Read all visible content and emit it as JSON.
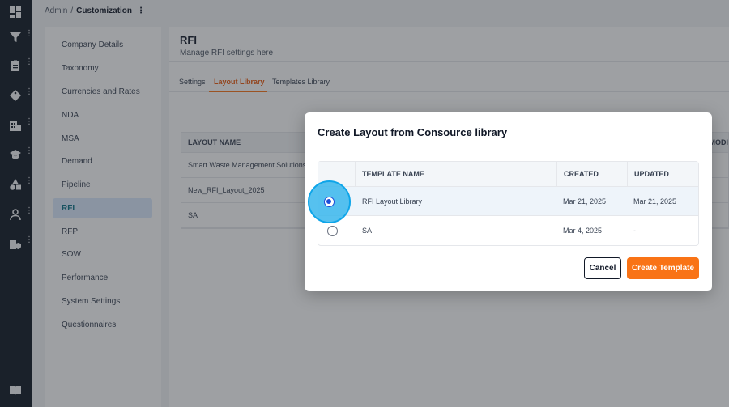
{
  "rail": {
    "items": [
      {
        "icon": "dashboard-icon"
      },
      {
        "icon": "filter-icon"
      },
      {
        "icon": "clipboard-icon"
      },
      {
        "icon": "tag-icon"
      },
      {
        "icon": "building-icon"
      },
      {
        "icon": "graduation-cap-icon"
      },
      {
        "icon": "shapes-icon"
      },
      {
        "icon": "user-icon"
      },
      {
        "icon": "shield-building-icon"
      }
    ],
    "bottom_icon": "book-icon"
  },
  "breadcrumb": {
    "parent": "Admin",
    "separator": "/",
    "current": "Customization",
    "kebab": "⋮"
  },
  "nav": {
    "items": [
      "Company Details",
      "Taxonomy",
      "Currencies and Rates",
      "NDA",
      "MSA",
      "Demand",
      "Pipeline",
      "RFI",
      "RFP",
      "SOW",
      "Performance",
      "System Settings",
      "Questionnaires"
    ],
    "active": "RFI"
  },
  "main": {
    "title": "RFI",
    "subtitle": "Manage RFI settings here",
    "tabs": [
      "Settings",
      "Layout Library",
      "Templates Library"
    ],
    "active_tab": "Layout Library",
    "table": {
      "header": "LAYOUT NAME",
      "header_right": "MODI",
      "rows": [
        "Smart Waste Management Solutions",
        "New_RFI_Layout_2025",
        "SA"
      ]
    }
  },
  "modal": {
    "title": "Create Layout from Consource library",
    "columns": [
      "TEMPLATE NAME",
      "CREATED",
      "UPDATED"
    ],
    "rows": [
      {
        "name": "RFI Layout Library",
        "created": "Mar 21, 2025",
        "updated": "Mar 21, 2025",
        "selected": true
      },
      {
        "name": "SA",
        "created": "Mar 4, 2025",
        "updated": "-",
        "selected": false
      }
    ],
    "cancel_label": "Cancel",
    "create_label": "Create Template"
  },
  "colors": {
    "accent": "#f97316",
    "rail": "#0f1923",
    "active_nav_bg": "#dbeafe",
    "highlight": "#38b6ec"
  }
}
